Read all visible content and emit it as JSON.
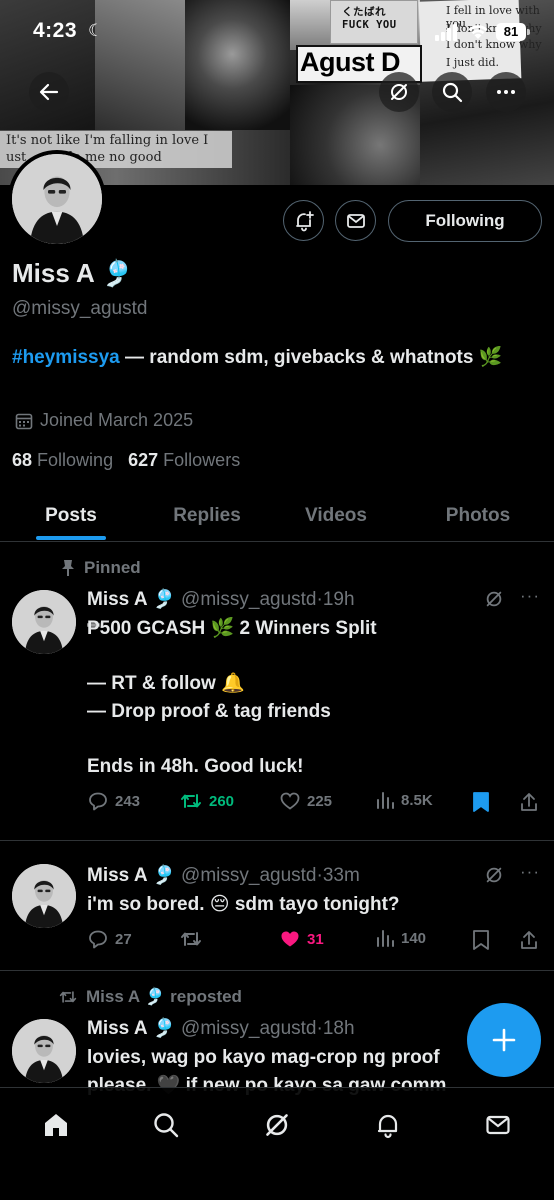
{
  "status_bar": {
    "time": "4:23",
    "battery": "81"
  },
  "banner": {
    "title_text": "Agust D",
    "sticker_lines": [
      "くたばれ",
      "FUCK YOU"
    ],
    "note_lines": [
      "I fell in love with you",
      "I don't know why",
      "I don't know why",
      "I just did."
    ],
    "quote_lines": [
      "It's not like I'm falling in love I",
      "ust … to do me no good"
    ]
  },
  "profile": {
    "name": "Miss A 🎐",
    "handle": "@missy_agustd",
    "bio_hashtag": "#heymissya",
    "bio_text": " — random sdm, givebacks & whatnots 🌿",
    "joined": "Joined March 2025",
    "following_count": "68",
    "following_label": "Following",
    "followers_count": "627",
    "followers_label": "Followers",
    "follow_button": "Following"
  },
  "tabs": [
    "Posts",
    "Replies",
    "Videos",
    "Photos"
  ],
  "posts": [
    {
      "pinned_label": "Pinned",
      "name": "Miss A 🎐",
      "handle": "@missy_agustd",
      "time": "19h",
      "text": "₱500 GCASH 🌿 2 Winners Split\n\n— RT & follow 🔔\n— Drop proof & tag friends\n\nEnds in 48h. Good luck!",
      "replies": "243",
      "reposts": "260",
      "likes": "225",
      "views": "8.5K"
    },
    {
      "name": "Miss A 🎐",
      "handle": "@missy_agustd",
      "time": "33m",
      "text": "i'm so bored. 😔 sdm tayo tonight?",
      "replies": "27",
      "reposts": "",
      "likes": "31",
      "views": "140"
    },
    {
      "repost_label": "Miss A 🎐 reposted",
      "name": "Miss A 🎐",
      "handle": "@missy_agustd",
      "time": "18h",
      "text": "lovies, wag po kayo mag-crop ng proof\nplease. 🖤 if new po kayo sa gaw comm"
    }
  ],
  "colors": {
    "accent": "#1d9bf0",
    "repost_green": "#00ba7c",
    "like_pink": "#f91880",
    "muted": "#71767b",
    "divider": "#2f3336"
  },
  "icons": {
    "back": "back-arrow-icon",
    "grok": "grok-icon",
    "search": "search-icon",
    "more": "more-icon",
    "subscribe": "bell-plus-icon",
    "message": "envelope-icon",
    "calendar": "calendar-icon",
    "pin": "pin-icon",
    "reply": "reply-icon",
    "repost": "repost-icon",
    "like": "heart-icon",
    "views": "views-icon",
    "bookmark": "bookmark-icon",
    "share": "share-icon",
    "compose": "plus-icon",
    "nav": [
      "home-icon",
      "search-icon",
      "grok-icon",
      "notifications-icon",
      "messages-icon"
    ]
  }
}
